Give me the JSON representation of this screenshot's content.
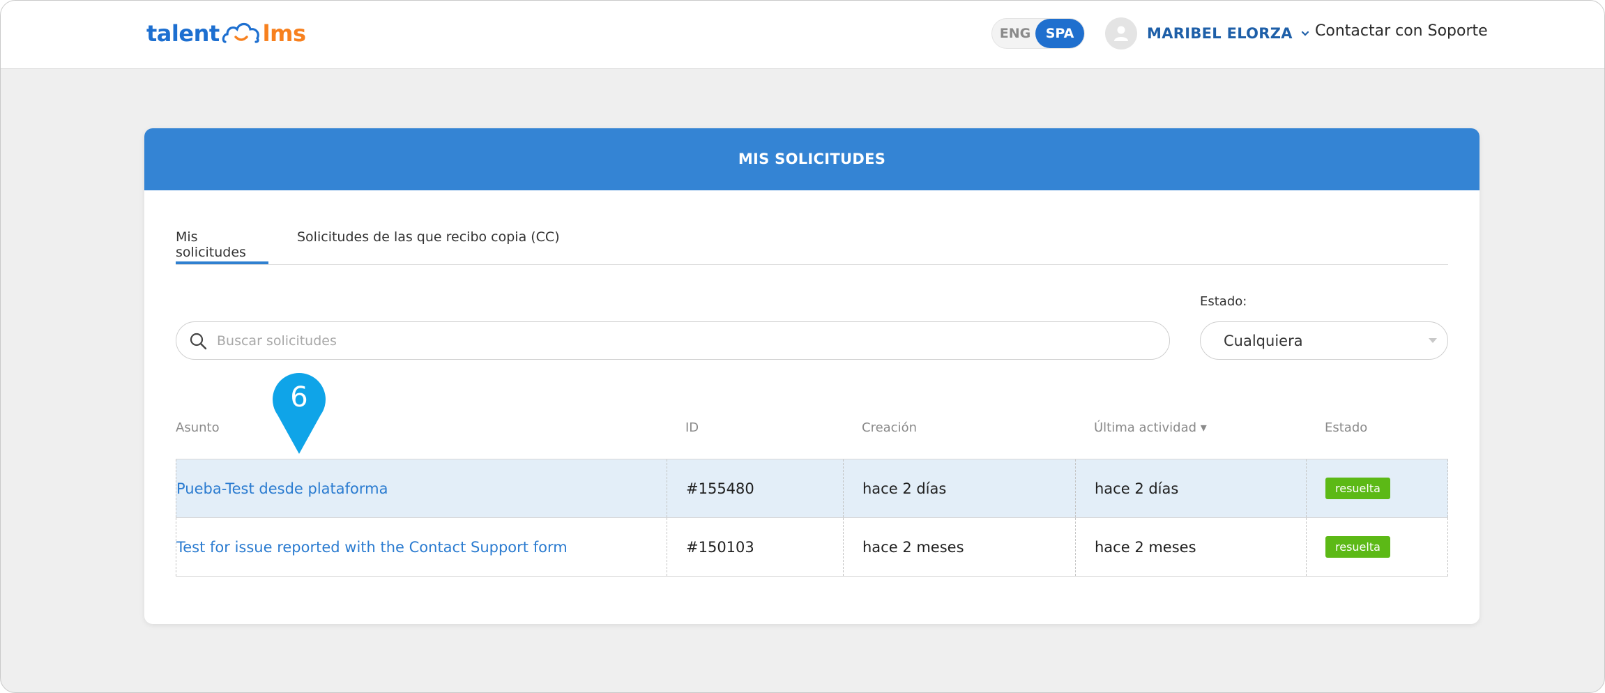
{
  "brand": {
    "logo_left": "talent",
    "logo_right": "lms",
    "colors": {
      "primary": "#1d6fd0",
      "accent": "#f7801e",
      "header": "#3484d4",
      "badge": "#5cb916",
      "marker": "#0fa4e8"
    }
  },
  "topbar": {
    "lang_eng": "ENG",
    "lang_spa": "SPA",
    "active_lang": "SPA",
    "user_name": "MARIBEL ELORZA",
    "support_link": "Contactar con Soporte"
  },
  "card": {
    "title": "MIS SOLICITUDES",
    "tabs": [
      {
        "label": "Mis solicitudes",
        "active": true
      },
      {
        "label": "Solicitudes de las que recibo copia (CC)",
        "active": false
      }
    ],
    "search": {
      "placeholder": "Buscar solicitudes",
      "value": ""
    },
    "status_filter": {
      "label": "Estado:",
      "selected": "Cualquiera"
    },
    "table": {
      "columns": {
        "asunto": "Asunto",
        "id": "ID",
        "creacion": "Creación",
        "ultima": "Última actividad ▾",
        "estado": "Estado"
      },
      "rows": [
        {
          "asunto": "Pueba-Test desde plataforma",
          "id": "#155480",
          "creacion": "hace 2 días",
          "ultima": "hace 2 días",
          "estado": "resuelta",
          "highlighted": true
        },
        {
          "asunto": "Test for issue reported with the Contact Support form",
          "id": "#150103",
          "creacion": "hace 2 meses",
          "ultima": "hace 2 meses",
          "estado": "resuelta",
          "highlighted": false
        }
      ]
    }
  },
  "step_marker": {
    "number": "6"
  }
}
